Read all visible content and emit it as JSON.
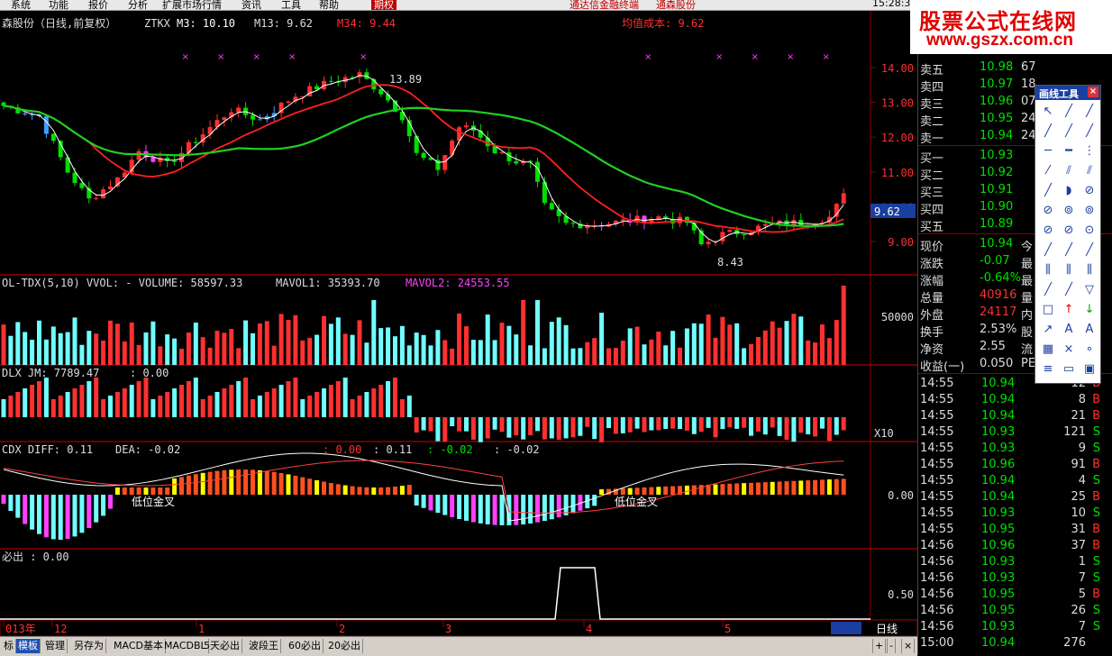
{
  "menu": {
    "items": [
      "系统",
      "功能",
      "报价",
      "分析",
      "扩展市场行情",
      "资讯",
      "工具",
      "帮助"
    ],
    "badge": "期权",
    "promo1": "通达信金融终端",
    "promo2": "通森股份",
    "clock": "15:28:3"
  },
  "logo": {
    "title": "股票公式在线网",
    "url": "www.gszx.com.cn"
  },
  "main_panel": {
    "header": "森股份（日线,前复权）",
    "ind_name": "ZTKX",
    "m3": "M3: 10.10",
    "m13": "M13: 9.62",
    "m34": "M34: 9.44",
    "cost": "均值成本: 9.62",
    "high_label": "13.89",
    "low_label": "8.43",
    "price_tag": "9.62",
    "y_ticks": [
      "14.00",
      "13.00",
      "12.00",
      "11.00",
      "10.00",
      "9.00"
    ]
  },
  "vol_panel": {
    "header": "OL-TDX(5,10) VVOL: -  VOLUME: 58597.33",
    "mavol1": "MAVOL1: 35393.70",
    "mavol2": "MAVOL2: 24553.55",
    "y_tick": "50000"
  },
  "jm_panel": {
    "header": "DLX JM: 7789.47",
    "header2": ": 0.00",
    "x10": "X10"
  },
  "macd_panel": {
    "header": "CDX DIFF: 0.11",
    "dea": "DEA: -0.02",
    "h1": ": 0.00",
    "h2": ": 0.11",
    "h3": ": -0.02",
    "h4": ": -0.02",
    "cross1": "低位金叉",
    "cross2": "低位金叉",
    "y_tick": "0.00"
  },
  "signal_panel": {
    "header": "必出 : 0.00",
    "y_tick": "0.50"
  },
  "time_axis": {
    "labels": [
      "013年",
      "12",
      "1",
      "2",
      "3",
      "4",
      "5"
    ],
    "period": "日线"
  },
  "tabs": [
    "标",
    "模板",
    "管理",
    "另存为",
    "MACD基本",
    "MACDBL",
    "5天必出",
    "波段王",
    "60必出",
    "20必出"
  ],
  "zoom": [
    "+",
    "-",
    "×"
  ],
  "quote": {
    "asks": [
      {
        "label": "卖五",
        "price": "10.98",
        "vol": "67"
      },
      {
        "label": "卖四",
        "price": "10.97",
        "vol": "18"
      },
      {
        "label": "卖三",
        "price": "10.96",
        "vol": "07"
      },
      {
        "label": "卖二",
        "price": "10.95",
        "vol": "24"
      },
      {
        "label": "卖一",
        "price": "10.94",
        "vol": "24"
      }
    ],
    "bids": [
      {
        "label": "买一",
        "price": "10.93",
        "vol": ""
      },
      {
        "label": "买二",
        "price": "10.92",
        "vol": ""
      },
      {
        "label": "买三",
        "price": "10.91",
        "vol": ""
      },
      {
        "label": "买四",
        "price": "10.90",
        "vol": ""
      },
      {
        "label": "买五",
        "price": "10.89",
        "vol": ""
      }
    ],
    "stats": [
      {
        "label": "现价",
        "value": "10.94",
        "tail": "今"
      },
      {
        "label": "涨跌",
        "value": "-0.07",
        "tail": "最"
      },
      {
        "label": "涨幅",
        "value": "-0.64%",
        "tail": "最"
      },
      {
        "label": "总量",
        "value": "40916",
        "tail": "量"
      },
      {
        "label": "外盘",
        "value": "24117",
        "tail": "内"
      },
      {
        "label": "换手",
        "value": "2.53%",
        "tail": "股"
      },
      {
        "label": "净资",
        "value": "2.55",
        "tail": "流"
      },
      {
        "label": "收益(一)",
        "value": "0.050",
        "tail": "PE"
      }
    ],
    "ticks": [
      {
        "time": "14:55",
        "price": "10.94",
        "vol": "12",
        "side": "B"
      },
      {
        "time": "14:55",
        "price": "10.94",
        "vol": "8",
        "side": "B"
      },
      {
        "time": "14:55",
        "price": "10.94",
        "vol": "21",
        "side": "B"
      },
      {
        "time": "14:55",
        "price": "10.93",
        "vol": "121",
        "side": "S"
      },
      {
        "time": "14:55",
        "price": "10.93",
        "vol": "9",
        "side": "S"
      },
      {
        "time": "14:55",
        "price": "10.96",
        "vol": "91",
        "side": "B"
      },
      {
        "time": "14:55",
        "price": "10.94",
        "vol": "4",
        "side": "S"
      },
      {
        "time": "14:55",
        "price": "10.94",
        "vol": "25",
        "side": "B"
      },
      {
        "time": "14:55",
        "price": "10.93",
        "vol": "10",
        "side": "S"
      },
      {
        "time": "14:55",
        "price": "10.95",
        "vol": "31",
        "side": "B"
      },
      {
        "time": "14:56",
        "price": "10.96",
        "vol": "37",
        "side": "B"
      },
      {
        "time": "14:56",
        "price": "10.93",
        "vol": "1",
        "side": "S"
      },
      {
        "time": "14:56",
        "price": "10.93",
        "vol": "7",
        "side": "S"
      },
      {
        "time": "14:56",
        "price": "10.95",
        "vol": "5",
        "side": "B"
      },
      {
        "time": "14:56",
        "price": "10.95",
        "vol": "26",
        "side": "S"
      },
      {
        "time": "14:56",
        "price": "10.93",
        "vol": "7",
        "side": "S"
      },
      {
        "time": "15:00",
        "price": "10.94",
        "vol": "276",
        "side": ""
      }
    ]
  },
  "tools": {
    "title": "画线工具",
    "close": "×"
  },
  "colors": {
    "up": "#ff3030",
    "down": "#00e000",
    "cyan": "#70ffff",
    "magenta": "#ff40ff",
    "yellow": "#ffff00",
    "grid": "#8b0000"
  }
}
